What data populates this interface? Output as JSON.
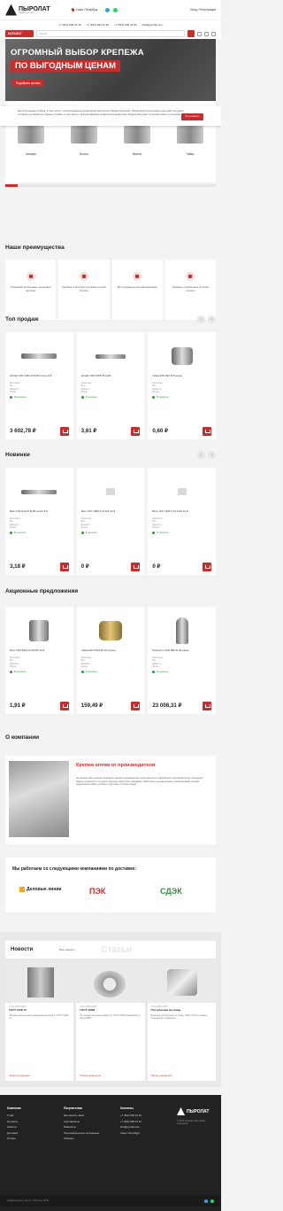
{
  "header": {
    "logo": "ПЫРОЛАТ",
    "logo_sub": "КРЕПЕЖ ОПТОМ",
    "city": "Санкт-Петербург",
    "account": "Вход / Регистрация",
    "phones": [
      "+7 (812) 605 44 18",
      "+7 (812) 603 44 19",
      "+7 (812) 605 44 55",
      "info@pyrolat.com"
    ]
  },
  "nav": {
    "catalog_label": "КАТАЛОГ",
    "search_placeholder": "Поиск"
  },
  "hero": {
    "line1": "ОГРОМНЫЙ ВЫБОР КРЕПЕЖА",
    "line2": "ПО ВЫГОДНЫМ ЦЕНАМ",
    "button": "Подобрать крепеж"
  },
  "cookie": {
    "text": "Мы используем Cookies, в том числе с использованием сервиса веб-аналитики \"Яндекс.Метрика\". Продолжая использовать наш сайт, вы даёте согласие на обработку данных Cookies, в том числе с использованием сервиса веб-аналитики \"Яндекс.Метрика\" в соответствии с политикой",
    "button": "Я согласен"
  },
  "categories": [
    "Анкеры",
    "Болты",
    "Винты",
    "Гайки"
  ],
  "advantages": {
    "title": "Наши преимущества",
    "items": [
      "Огромный ассортимент крепежа в наличии",
      "Удобная и быстрая доставка по всей России",
      "Вся продукция сертифицирована",
      "Удобные и различные способы оплаты"
    ]
  },
  "top_sales": {
    "title": "Топ продаж",
    "products": [
      {
        "name": "Штифт DIN 1481 М 5х30 сталь 6.8",
        "price": "3 602,78 ₽",
        "stock": "В наличии"
      },
      {
        "name": "Штифт DIN 6325 М 4х20",
        "price": "3,61 ₽",
        "stock": "В наличии"
      },
      {
        "name": "Гайка DIN 934 М 5 нерж.",
        "price": "0,60 ₽",
        "stock": "В наличии"
      }
    ]
  },
  "new_items": {
    "title": "Новинки",
    "products": [
      {
        "name": "Винт DIN 912 M 8х35 класс 8.8",
        "price": "3,18 ₽",
        "stock": "В наличии"
      },
      {
        "name": "Винт ISO 7380-1 М 3х6 12.9",
        "price": "0 ₽",
        "stock": "В наличии"
      },
      {
        "name": "Винт ISO 7380-1 М 3х10 12.9",
        "price": "0 ₽",
        "stock": "В наличии"
      }
    ]
  },
  "offers": {
    "title": "Акционные предложения",
    "products": [
      {
        "name": "Болт DIN 6914 M 20х55 10.9",
        "price": "1,91 ₽",
        "stock": "В наличии"
      },
      {
        "name": "Гайка DIN 6334 M 30 латунь",
        "price": "159,49 ₽",
        "stock": "В наличии"
      },
      {
        "name": "Рым-болт DIN 580 М 30 нерж.",
        "price": "23 008,31 ₽",
        "stock": "В наличии"
      }
    ]
  },
  "spec_labels": [
    "Материал",
    "Вес",
    "Диаметр",
    "Длина"
  ],
  "about": {
    "title": "О компании",
    "heading": "Крепеж оптом от производителя",
    "text": "На нашем сайте можно подобрать крепеж производства отечественных и зарубежных производителей. Складские запасы позволяют отгружать крупные партии без ожидания. Работаем с юридическими и физическими лицами, предлагаем гибкие условия и доставку по всей стране."
  },
  "partners": {
    "title": "Мы работаем со следующими компаниями по доставке:",
    "logos": [
      "Деловые линии",
      "ПЭК",
      "СДЭК"
    ]
  },
  "news": {
    "title": "Новости",
    "all_link": "Все новости",
    "ghost": "Статьи",
    "items": [
      {
        "date": "13 октября 2023",
        "title": "ГОСТ 5128-70",
        "text": "Пазовая шпилька для соединения деталей по ГОСТ 5128-70",
        "more": "Читать полностью"
      },
      {
        "date": "13 октября 2023",
        "title": "ГОСТ 11860",
        "text": "На складе постоянно шайбы по ГОСТ 11860 размерами от М4 до М36",
        "more": "Читать полностью"
      },
      {
        "date": "13 октября 2023",
        "title": "Поступление на склад",
        "text": "Большое поступление на склад. Гайки и болты разных стандартов и размеров.",
        "more": "Читать полностью"
      }
    ]
  },
  "footer": {
    "col1": {
      "title": "Компания",
      "items": [
        "О нас",
        "Контакты",
        "Новости",
        "Доставка",
        "Оплата"
      ]
    },
    "col2": {
      "title": "Покупателям",
      "items": [
        "Как сделать заказ",
        "Сертификаты",
        "Реквизиты",
        "Пользовательское соглашение",
        "Таблицы"
      ]
    },
    "col3": {
      "title": "Контакты",
      "items": [
        "+7 (812) 605 44 18",
        "+7 (812) 605 44 19",
        "info@pyrolat.com",
        "Санкт-Петербург"
      ]
    },
    "copyright": "© 2023 Пыролат. Все права защищены",
    "hours": "График работы: Пн-Пт с 10:00 до 18:00"
  }
}
